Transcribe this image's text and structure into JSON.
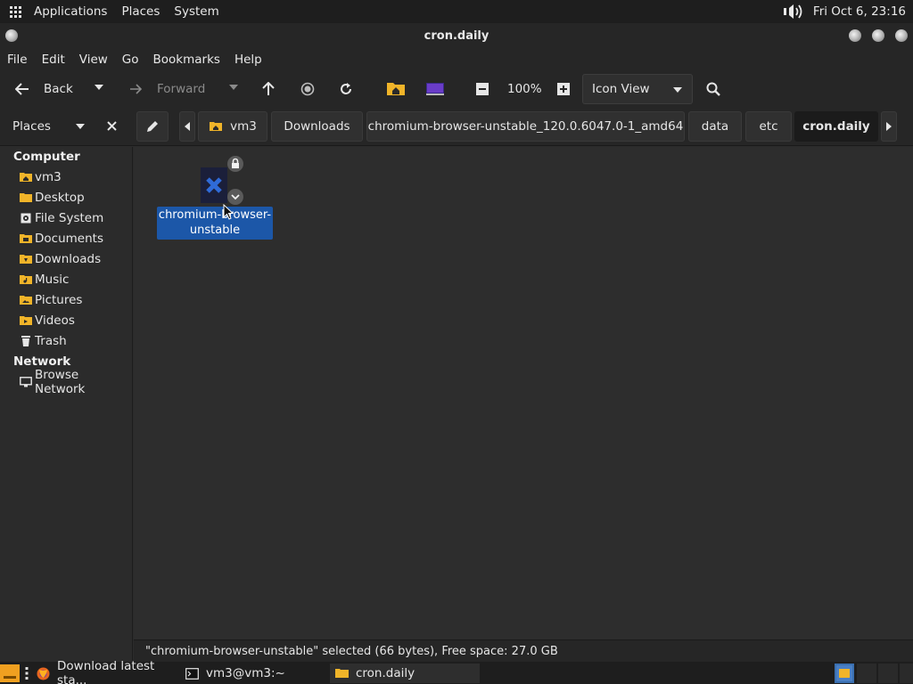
{
  "top_panel": {
    "menus": [
      "Applications",
      "Places",
      "System"
    ],
    "clock": "Fri Oct  6, 23:16"
  },
  "window": {
    "title": "cron.daily"
  },
  "menubar": [
    "File",
    "Edit",
    "View",
    "Go",
    "Bookmarks",
    "Help"
  ],
  "toolbar": {
    "back_label": "Back",
    "forward_label": "Forward",
    "zoom_level": "100%",
    "view_mode": "Icon View"
  },
  "location": {
    "places_label": "Places",
    "crumbs": [
      "vm3",
      "Downloads",
      "chromium-browser-unstable_120.0.6047.0-1_amd64",
      "data",
      "etc",
      "cron.daily"
    ]
  },
  "sidebar": {
    "computer_heading": "Computer",
    "computer_items": [
      "vm3",
      "Desktop",
      "File System",
      "Documents",
      "Downloads",
      "Music",
      "Pictures",
      "Videos",
      "Trash"
    ],
    "network_heading": "Network",
    "network_items": [
      "Browse Network"
    ]
  },
  "content": {
    "file": {
      "name_line1": "chromium-browser-",
      "name_line2": "unstable"
    }
  },
  "status": {
    "text": "\"chromium-browser-unstable\" selected (66 bytes), Free space: 27.0 GB"
  },
  "taskbar": {
    "tasks": [
      "Download latest sta...",
      "vm3@vm3:~",
      "cron.daily"
    ]
  },
  "colors": {
    "selection": "#1c57a8",
    "folder": "#f0b429",
    "background": "#2b2b2b"
  }
}
